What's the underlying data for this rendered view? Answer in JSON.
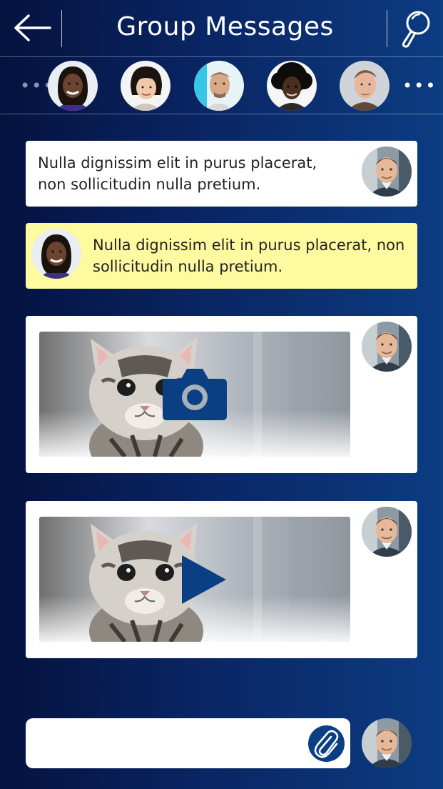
{
  "header": {
    "title": "Group Messages",
    "back_icon": "arrow-left-icon",
    "search_icon": "search-icon"
  },
  "contacts": [
    {
      "avatar": "woman-smiling-avatar"
    },
    {
      "avatar": "woman-short-hair-avatar"
    },
    {
      "avatar": "man-shaved-head-avatar"
    },
    {
      "avatar": "man-afro-avatar"
    },
    {
      "avatar": "man-short-hair-avatar"
    }
  ],
  "messages": [
    {
      "type": "text",
      "text": "Nulla dignissim elit in purus placerat, non sollicitudin nulla pretium.",
      "sender_side": "right"
    },
    {
      "type": "text",
      "text": "Nulla dignissim elit in purus placerat, non sollicitudin nulla pretium.",
      "sender_side": "left",
      "highlight": "#fefa9f"
    },
    {
      "type": "photo",
      "overlay_icon": "camera-icon",
      "sender_side": "right"
    },
    {
      "type": "video",
      "overlay_icon": "play-icon",
      "sender_side": "right"
    }
  ],
  "compose": {
    "placeholder": "",
    "attach_icon": "paperclip-icon"
  },
  "colors": {
    "accent": "#0b3f83",
    "highlight": "#fefa9f",
    "background_start": "#04123f",
    "background_end": "#0c3c82"
  }
}
